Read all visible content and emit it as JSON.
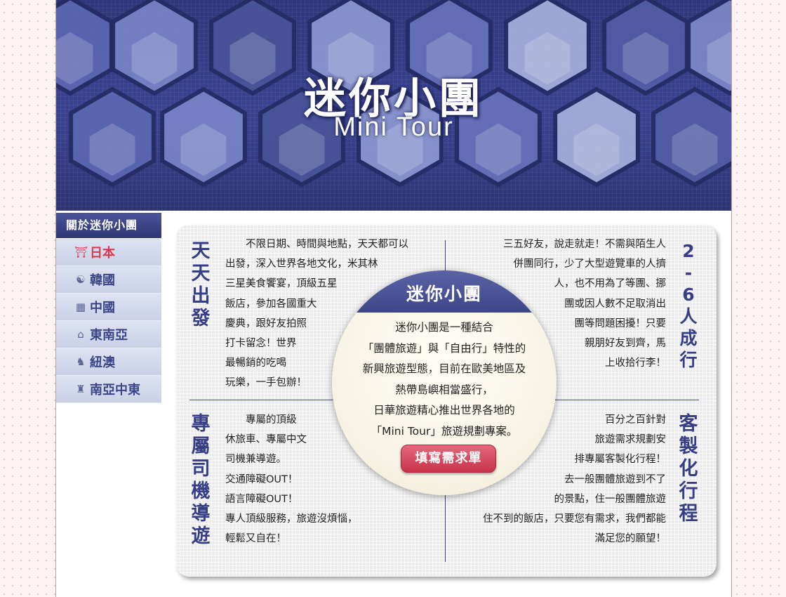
{
  "banner": {
    "title": "迷你小團",
    "subtitle": "Mini Tour"
  },
  "sidebar": {
    "header": "關於迷你小團",
    "items": [
      {
        "label": "日本",
        "icon": "torii-icon",
        "active": true
      },
      {
        "label": "韓國",
        "icon": "swirl-icon"
      },
      {
        "label": "中國",
        "icon": "map-icon"
      },
      {
        "label": "東南亞",
        "icon": "temple-icon"
      },
      {
        "label": "紐澳",
        "icon": "kangaroo-icon"
      },
      {
        "label": "南亞中東",
        "icon": "statue-icon"
      }
    ]
  },
  "sections": {
    "top_left": {
      "title": "天天出發",
      "text": "　　不限日期、時間與地點，天天都可以\n出發，深入世界各地文化，米其林\n三星美食饗宴，頂級五星\n飯店，參加各國重大\n慶典，跟好友拍照\n打卡留念！世界\n最暢銷的吃喝\n玩樂，一手包辦！"
    },
    "top_right": {
      "title": "2-6人成行",
      "text": "三五好友，說走就走！不需與陌生人\n併團同行，少了大型遊覽車的人擠\n人，也不用為了等團、挪\n團或因人數不足取消出\n團等問題困擾！只要\n親朋好友到齊，馬\n上收拾行李！"
    },
    "bottom_left": {
      "title": "專屬司機導遊",
      "text": "　　專屬的頂級\n休旅車、專屬中文\n司機兼導遊。\n交通障礙OUT！\n語言障礙OUT！\n專人頂級服務，旅遊沒煩惱，\n輕鬆又自在！"
    },
    "bottom_right": {
      "title": "客製化行程",
      "text": "百分之百針對\n旅遊需求規劃安\n排專屬客製化行程！\n去一般團體旅遊到不了\n的景點，住一般團體旅遊\n住不到的飯店，只要您有需求，我們都能\n滿足您的願望！"
    }
  },
  "center": {
    "title": "迷你小團",
    "text": "迷你小團是一種結合\n「團體旅遊」與「自由行」特性的\n新興旅遊型態，目前在歐美地區及\n熱帶島嶼相當盛行，\n日華旅遊精心推出世界各地的\n「Mini Tour」旅遊規劃專案。",
    "button": "填寫需求單"
  },
  "colors": {
    "navy": "#363f86",
    "accent_red": "#d8394f",
    "sidebar_bg": "#d3d9eb"
  }
}
